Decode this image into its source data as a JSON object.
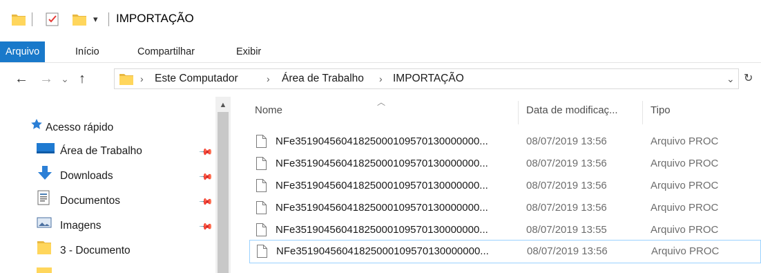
{
  "window": {
    "title": "IMPORTAÇÃO"
  },
  "quick_access_toolbar": {
    "dropdown_glyph": "▾"
  },
  "ribbon": {
    "tabs": [
      {
        "label": "Arquivo",
        "active": true
      },
      {
        "label": "Início"
      },
      {
        "label": "Compartilhar"
      },
      {
        "label": "Exibir"
      }
    ]
  },
  "nav": {
    "back": "←",
    "forward": "→",
    "recent": "⌄",
    "up": "↑",
    "refresh": "↻",
    "address_dropdown": "⌄"
  },
  "address": {
    "breadcrumbs": [
      "Este Computador",
      "Área de Trabalho",
      "IMPORTAÇÃO"
    ]
  },
  "sidebar": {
    "items": [
      {
        "label": "Acesso rápido",
        "icon": "star-icon"
      },
      {
        "label": "Área de Trabalho",
        "icon": "desktop-icon",
        "pinned": true
      },
      {
        "label": "Downloads",
        "icon": "download-icon",
        "pinned": true
      },
      {
        "label": "Documentos",
        "icon": "documents-icon",
        "pinned": true
      },
      {
        "label": "Imagens",
        "icon": "pictures-icon",
        "pinned": true
      },
      {
        "label": "3 - Documento",
        "icon": "folder-icon"
      }
    ]
  },
  "file_list": {
    "columns": {
      "name": "Nome",
      "date": "Data de modificaç...",
      "type": "Tipo"
    },
    "files": [
      {
        "name": "NFe35190456041825000109570130000000...",
        "date": "08/07/2019 13:56",
        "type": "Arquivo PROC"
      },
      {
        "name": "NFe35190456041825000109570130000000...",
        "date": "08/07/2019 13:56",
        "type": "Arquivo PROC"
      },
      {
        "name": "NFe35190456041825000109570130000000...",
        "date": "08/07/2019 13:56",
        "type": "Arquivo PROC"
      },
      {
        "name": "NFe35190456041825000109570130000000...",
        "date": "08/07/2019 13:56",
        "type": "Arquivo PROC"
      },
      {
        "name": "NFe35190456041825000109570130000000...",
        "date": "08/07/2019 13:55",
        "type": "Arquivo PROC"
      },
      {
        "name": "NFe35190456041825000109570130000000...",
        "date": "08/07/2019 13:56",
        "type": "Arquivo PROC",
        "focused": true
      }
    ]
  },
  "colors": {
    "accent": "#1979ca",
    "folder": "#ffd65c",
    "focus_border": "#99d1ff"
  }
}
